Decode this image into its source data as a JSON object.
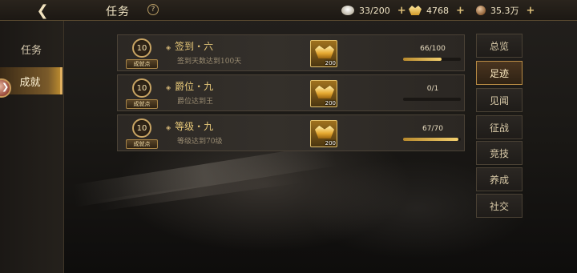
{
  "header": {
    "back_icon": "back-arrow-icon",
    "title": "任务",
    "help_label": "?"
  },
  "resources": [
    {
      "icon": "silver-ingot-icon",
      "value": "33/200"
    },
    {
      "icon": "gold-ingot-icon",
      "value": "4768"
    },
    {
      "icon": "copper-coin-icon",
      "value": "35.3万"
    }
  ],
  "left_tabs": [
    {
      "label": "任务",
      "active": false
    },
    {
      "label": "成就",
      "active": true
    }
  ],
  "achievements": [
    {
      "points": "10",
      "points_label": "成就点",
      "name": "签到・六",
      "desc": "签到天数达到100天",
      "reward_count": "200",
      "progress_text": "66/100",
      "progress": 0.66
    },
    {
      "points": "10",
      "points_label": "成就点",
      "name": "爵位・九",
      "desc": "爵位达到王",
      "reward_count": "200",
      "progress_text": "0/1",
      "progress": 0.0
    },
    {
      "points": "10",
      "points_label": "成就点",
      "name": "等级・九",
      "desc": "等级达到70级",
      "reward_count": "200",
      "progress_text": "67/70",
      "progress": 0.957
    }
  ],
  "categories": [
    {
      "label": "总览",
      "active": false
    },
    {
      "label": "足迹",
      "active": true
    },
    {
      "label": "见闻",
      "active": false
    },
    {
      "label": "征战",
      "active": false
    },
    {
      "label": "竞技",
      "active": false
    },
    {
      "label": "养成",
      "active": false
    },
    {
      "label": "社交",
      "active": false
    }
  ],
  "colors": {
    "accent_gold": "#e7c879",
    "progress_fill": "#f3cf6e"
  }
}
